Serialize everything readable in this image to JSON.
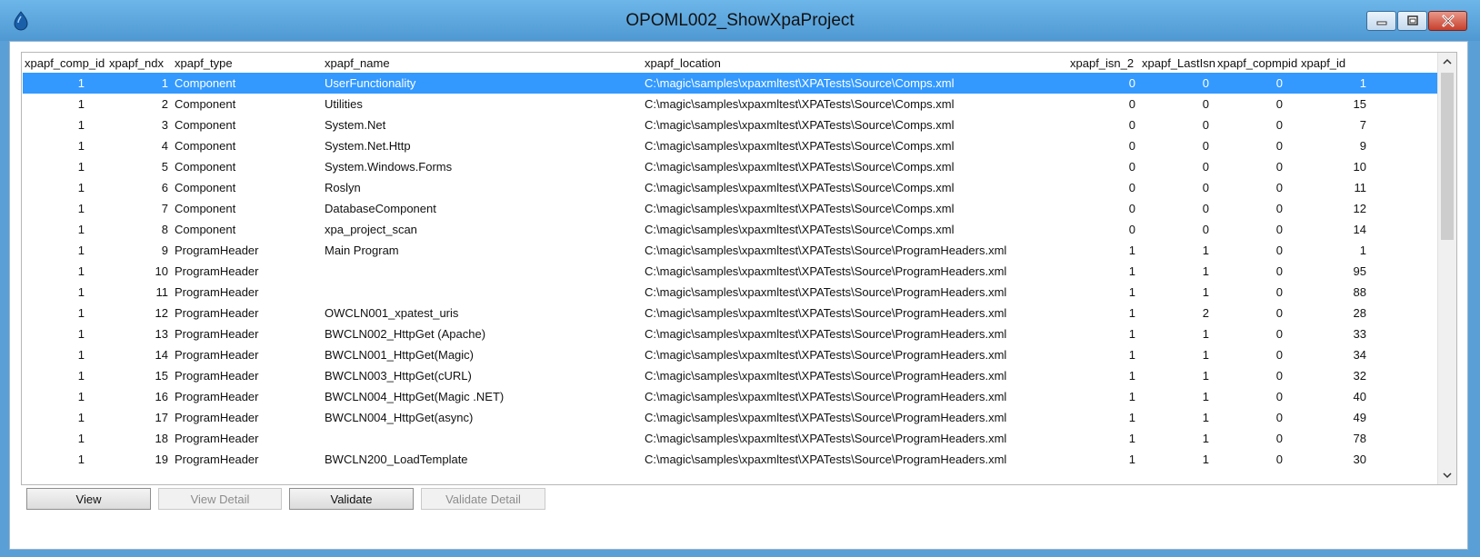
{
  "window": {
    "title": "OPOML002_ShowXpaProject"
  },
  "columns": [
    "xpapf_comp_id",
    "xpapf_ndx",
    "xpapf_type",
    "xpapf_name",
    "xpapf_location",
    "xpapf_isn_2",
    "xpapf_LastIsn",
    "xpapf_copmpid",
    "xpapf_id"
  ],
  "rows": [
    {
      "comp_id": "1",
      "ndx": "1",
      "type": "Component",
      "name": "UserFunctionality",
      "location": "C:\\magic\\samples\\xpaxmltest\\XPATests\\Source\\Comps.xml",
      "isn_2": "0",
      "lastisn": "0",
      "copmpid": "0",
      "id": "1"
    },
    {
      "comp_id": "1",
      "ndx": "2",
      "type": "Component",
      "name": "Utilities",
      "location": "C:\\magic\\samples\\xpaxmltest\\XPATests\\Source\\Comps.xml",
      "isn_2": "0",
      "lastisn": "0",
      "copmpid": "0",
      "id": "15"
    },
    {
      "comp_id": "1",
      "ndx": "3",
      "type": "Component",
      "name": "System.Net",
      "location": "C:\\magic\\samples\\xpaxmltest\\XPATests\\Source\\Comps.xml",
      "isn_2": "0",
      "lastisn": "0",
      "copmpid": "0",
      "id": "7"
    },
    {
      "comp_id": "1",
      "ndx": "4",
      "type": "Component",
      "name": "System.Net.Http",
      "location": "C:\\magic\\samples\\xpaxmltest\\XPATests\\Source\\Comps.xml",
      "isn_2": "0",
      "lastisn": "0",
      "copmpid": "0",
      "id": "9"
    },
    {
      "comp_id": "1",
      "ndx": "5",
      "type": "Component",
      "name": "System.Windows.Forms",
      "location": "C:\\magic\\samples\\xpaxmltest\\XPATests\\Source\\Comps.xml",
      "isn_2": "0",
      "lastisn": "0",
      "copmpid": "0",
      "id": "10"
    },
    {
      "comp_id": "1",
      "ndx": "6",
      "type": "Component",
      "name": "Roslyn",
      "location": "C:\\magic\\samples\\xpaxmltest\\XPATests\\Source\\Comps.xml",
      "isn_2": "0",
      "lastisn": "0",
      "copmpid": "0",
      "id": "11"
    },
    {
      "comp_id": "1",
      "ndx": "7",
      "type": "Component",
      "name": "DatabaseComponent",
      "location": "C:\\magic\\samples\\xpaxmltest\\XPATests\\Source\\Comps.xml",
      "isn_2": "0",
      "lastisn": "0",
      "copmpid": "0",
      "id": "12"
    },
    {
      "comp_id": "1",
      "ndx": "8",
      "type": "Component",
      "name": "xpa_project_scan",
      "location": "C:\\magic\\samples\\xpaxmltest\\XPATests\\Source\\Comps.xml",
      "isn_2": "0",
      "lastisn": "0",
      "copmpid": "0",
      "id": "14"
    },
    {
      "comp_id": "1",
      "ndx": "9",
      "type": "ProgramHeader",
      "name": "Main Program",
      "location": "C:\\magic\\samples\\xpaxmltest\\XPATests\\Source\\ProgramHeaders.xml",
      "isn_2": "1",
      "lastisn": "1",
      "copmpid": "0",
      "id": "1"
    },
    {
      "comp_id": "1",
      "ndx": "10",
      "type": "ProgramHeader",
      "name": "",
      "location": "C:\\magic\\samples\\xpaxmltest\\XPATests\\Source\\ProgramHeaders.xml",
      "isn_2": "1",
      "lastisn": "1",
      "copmpid": "0",
      "id": "95"
    },
    {
      "comp_id": "1",
      "ndx": "11",
      "type": "ProgramHeader",
      "name": "",
      "location": "C:\\magic\\samples\\xpaxmltest\\XPATests\\Source\\ProgramHeaders.xml",
      "isn_2": "1",
      "lastisn": "1",
      "copmpid": "0",
      "id": "88"
    },
    {
      "comp_id": "1",
      "ndx": "12",
      "type": "ProgramHeader",
      "name": "OWCLN001_xpatest_uris",
      "location": "C:\\magic\\samples\\xpaxmltest\\XPATests\\Source\\ProgramHeaders.xml",
      "isn_2": "1",
      "lastisn": "2",
      "copmpid": "0",
      "id": "28"
    },
    {
      "comp_id": "1",
      "ndx": "13",
      "type": "ProgramHeader",
      "name": "BWCLN002_HttpGet (Apache)",
      "location": "C:\\magic\\samples\\xpaxmltest\\XPATests\\Source\\ProgramHeaders.xml",
      "isn_2": "1",
      "lastisn": "1",
      "copmpid": "0",
      "id": "33"
    },
    {
      "comp_id": "1",
      "ndx": "14",
      "type": "ProgramHeader",
      "name": "BWCLN001_HttpGet(Magic)",
      "location": "C:\\magic\\samples\\xpaxmltest\\XPATests\\Source\\ProgramHeaders.xml",
      "isn_2": "1",
      "lastisn": "1",
      "copmpid": "0",
      "id": "34"
    },
    {
      "comp_id": "1",
      "ndx": "15",
      "type": "ProgramHeader",
      "name": "BWCLN003_HttpGet(cURL)",
      "location": "C:\\magic\\samples\\xpaxmltest\\XPATests\\Source\\ProgramHeaders.xml",
      "isn_2": "1",
      "lastisn": "1",
      "copmpid": "0",
      "id": "32"
    },
    {
      "comp_id": "1",
      "ndx": "16",
      "type": "ProgramHeader",
      "name": "BWCLN004_HttpGet(Magic .NET)",
      "location": "C:\\magic\\samples\\xpaxmltest\\XPATests\\Source\\ProgramHeaders.xml",
      "isn_2": "1",
      "lastisn": "1",
      "copmpid": "0",
      "id": "40"
    },
    {
      "comp_id": "1",
      "ndx": "17",
      "type": "ProgramHeader",
      "name": "BWCLN004_HttpGet(async)",
      "location": "C:\\magic\\samples\\xpaxmltest\\XPATests\\Source\\ProgramHeaders.xml",
      "isn_2": "1",
      "lastisn": "1",
      "copmpid": "0",
      "id": "49"
    },
    {
      "comp_id": "1",
      "ndx": "18",
      "type": "ProgramHeader",
      "name": "",
      "location": "C:\\magic\\samples\\xpaxmltest\\XPATests\\Source\\ProgramHeaders.xml",
      "isn_2": "1",
      "lastisn": "1",
      "copmpid": "0",
      "id": "78"
    },
    {
      "comp_id": "1",
      "ndx": "19",
      "type": "ProgramHeader",
      "name": "BWCLN200_LoadTemplate",
      "location": "C:\\magic\\samples\\xpaxmltest\\XPATests\\Source\\ProgramHeaders.xml",
      "isn_2": "1",
      "lastisn": "1",
      "copmpid": "0",
      "id": "30"
    }
  ],
  "selected_row": 0,
  "buttons": {
    "view": "View",
    "view_detail": "View Detail",
    "validate": "Validate",
    "validate_detail": "Validate Detail"
  },
  "colors": {
    "selection": "#3399ff",
    "title_bar": "#5aa0d6"
  },
  "icons": {
    "app": "magic-app-icon",
    "minimize": "minimize-icon",
    "maximize": "maximize-icon",
    "close": "close-icon",
    "scroll_up": "chevron-up-icon",
    "scroll_down": "chevron-down-icon"
  }
}
